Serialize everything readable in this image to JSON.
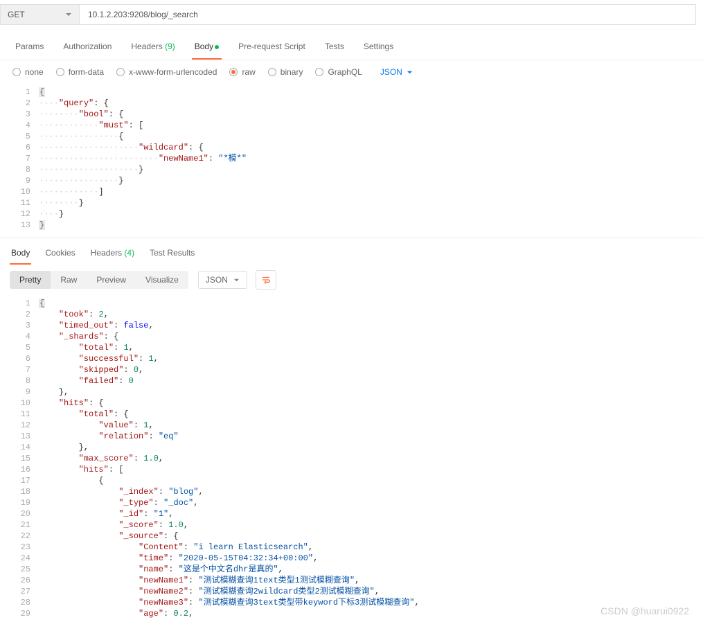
{
  "request": {
    "method": "GET",
    "url": "10.1.2.203:9208/blog/_search"
  },
  "tabs": [
    {
      "label": "Params"
    },
    {
      "label": "Authorization"
    },
    {
      "label": "Headers",
      "count": "(9)"
    },
    {
      "label": "Body",
      "active": true,
      "dot": true
    },
    {
      "label": "Pre-request Script"
    },
    {
      "label": "Tests"
    },
    {
      "label": "Settings"
    }
  ],
  "body_types": [
    {
      "label": "none"
    },
    {
      "label": "form-data"
    },
    {
      "label": "x-www-form-urlencoded"
    },
    {
      "label": "raw",
      "checked": true
    },
    {
      "label": "binary"
    },
    {
      "label": "GraphQL"
    }
  ],
  "lang_select": "JSON",
  "request_body_lines": [
    {
      "n": "1",
      "t": [
        {
          "c": "cursor-mark",
          "v": "{"
        }
      ]
    },
    {
      "n": "2",
      "t": [
        {
          "c": "dot-ws",
          "v": "····"
        },
        {
          "c": "k",
          "v": "\"query\""
        },
        {
          "c": "p",
          "v": ": {"
        }
      ]
    },
    {
      "n": "3",
      "t": [
        {
          "c": "dot-ws",
          "v": "········"
        },
        {
          "c": "k",
          "v": "\"bool\""
        },
        {
          "c": "p",
          "v": ": {"
        }
      ]
    },
    {
      "n": "4",
      "t": [
        {
          "c": "dot-ws",
          "v": "············"
        },
        {
          "c": "k",
          "v": "\"must\""
        },
        {
          "c": "p",
          "v": ": ["
        }
      ]
    },
    {
      "n": "5",
      "t": [
        {
          "c": "dot-ws",
          "v": "················"
        },
        {
          "c": "p",
          "v": "{"
        }
      ]
    },
    {
      "n": "6",
      "t": [
        {
          "c": "dot-ws",
          "v": "····················"
        },
        {
          "c": "k",
          "v": "\"wildcard\""
        },
        {
          "c": "p",
          "v": ": {"
        }
      ]
    },
    {
      "n": "7",
      "t": [
        {
          "c": "dot-ws",
          "v": "························"
        },
        {
          "c": "k",
          "v": "\"newName1\""
        },
        {
          "c": "p",
          "v": ": "
        },
        {
          "c": "s",
          "v": "\"*模*\""
        }
      ]
    },
    {
      "n": "8",
      "t": [
        {
          "c": "dot-ws",
          "v": "····················"
        },
        {
          "c": "p",
          "v": "}"
        }
      ]
    },
    {
      "n": "9",
      "t": [
        {
          "c": "dot-ws",
          "v": "················"
        },
        {
          "c": "p",
          "v": "}"
        }
      ]
    },
    {
      "n": "10",
      "t": [
        {
          "c": "dot-ws",
          "v": "············"
        },
        {
          "c": "p",
          "v": "]"
        }
      ]
    },
    {
      "n": "11",
      "t": [
        {
          "c": "dot-ws",
          "v": "········"
        },
        {
          "c": "p",
          "v": "}"
        }
      ]
    },
    {
      "n": "12",
      "t": [
        {
          "c": "dot-ws",
          "v": "····"
        },
        {
          "c": "p",
          "v": "}"
        }
      ]
    },
    {
      "n": "13",
      "t": [
        {
          "c": "cursor-mark",
          "v": "}"
        }
      ]
    }
  ],
  "response_tabs": [
    {
      "label": "Body",
      "active": true
    },
    {
      "label": "Cookies"
    },
    {
      "label": "Headers",
      "count": "(4)"
    },
    {
      "label": "Test Results"
    }
  ],
  "view_modes": [
    {
      "label": "Pretty",
      "active": true
    },
    {
      "label": "Raw"
    },
    {
      "label": "Preview"
    },
    {
      "label": "Visualize"
    }
  ],
  "resp_fmt": "JSON",
  "response_body_lines": [
    {
      "n": "1",
      "t": [
        {
          "c": "cursor-mark",
          "v": "{"
        }
      ]
    },
    {
      "n": "2",
      "t": [
        {
          "c": "p",
          "v": "    "
        },
        {
          "c": "k",
          "v": "\"took\""
        },
        {
          "c": "p",
          "v": ": "
        },
        {
          "c": "n",
          "v": "2"
        },
        {
          "c": "p",
          "v": ","
        }
      ]
    },
    {
      "n": "3",
      "t": [
        {
          "c": "p",
          "v": "    "
        },
        {
          "c": "k",
          "v": "\"timed_out\""
        },
        {
          "c": "p",
          "v": ": "
        },
        {
          "c": "b",
          "v": "false"
        },
        {
          "c": "p",
          "v": ","
        }
      ]
    },
    {
      "n": "4",
      "t": [
        {
          "c": "p",
          "v": "    "
        },
        {
          "c": "k",
          "v": "\"_shards\""
        },
        {
          "c": "p",
          "v": ": {"
        }
      ]
    },
    {
      "n": "5",
      "t": [
        {
          "c": "p",
          "v": "        "
        },
        {
          "c": "k",
          "v": "\"total\""
        },
        {
          "c": "p",
          "v": ": "
        },
        {
          "c": "n",
          "v": "1"
        },
        {
          "c": "p",
          "v": ","
        }
      ]
    },
    {
      "n": "6",
      "t": [
        {
          "c": "p",
          "v": "        "
        },
        {
          "c": "k",
          "v": "\"successful\""
        },
        {
          "c": "p",
          "v": ": "
        },
        {
          "c": "n",
          "v": "1"
        },
        {
          "c": "p",
          "v": ","
        }
      ]
    },
    {
      "n": "7",
      "t": [
        {
          "c": "p",
          "v": "        "
        },
        {
          "c": "k",
          "v": "\"skipped\""
        },
        {
          "c": "p",
          "v": ": "
        },
        {
          "c": "n",
          "v": "0"
        },
        {
          "c": "p",
          "v": ","
        }
      ]
    },
    {
      "n": "8",
      "t": [
        {
          "c": "p",
          "v": "        "
        },
        {
          "c": "k",
          "v": "\"failed\""
        },
        {
          "c": "p",
          "v": ": "
        },
        {
          "c": "n",
          "v": "0"
        }
      ]
    },
    {
      "n": "9",
      "t": [
        {
          "c": "p",
          "v": "    },"
        }
      ]
    },
    {
      "n": "10",
      "t": [
        {
          "c": "p",
          "v": "    "
        },
        {
          "c": "k",
          "v": "\"hits\""
        },
        {
          "c": "p",
          "v": ": {"
        }
      ]
    },
    {
      "n": "11",
      "t": [
        {
          "c": "p",
          "v": "        "
        },
        {
          "c": "k",
          "v": "\"total\""
        },
        {
          "c": "p",
          "v": ": {"
        }
      ]
    },
    {
      "n": "12",
      "t": [
        {
          "c": "p",
          "v": "            "
        },
        {
          "c": "k",
          "v": "\"value\""
        },
        {
          "c": "p",
          "v": ": "
        },
        {
          "c": "n",
          "v": "1"
        },
        {
          "c": "p",
          "v": ","
        }
      ]
    },
    {
      "n": "13",
      "t": [
        {
          "c": "p",
          "v": "            "
        },
        {
          "c": "k",
          "v": "\"relation\""
        },
        {
          "c": "p",
          "v": ": "
        },
        {
          "c": "s",
          "v": "\"eq\""
        }
      ]
    },
    {
      "n": "14",
      "t": [
        {
          "c": "p",
          "v": "        },"
        }
      ]
    },
    {
      "n": "15",
      "t": [
        {
          "c": "p",
          "v": "        "
        },
        {
          "c": "k",
          "v": "\"max_score\""
        },
        {
          "c": "p",
          "v": ": "
        },
        {
          "c": "n",
          "v": "1.0"
        },
        {
          "c": "p",
          "v": ","
        }
      ]
    },
    {
      "n": "16",
      "t": [
        {
          "c": "p",
          "v": "        "
        },
        {
          "c": "k",
          "v": "\"hits\""
        },
        {
          "c": "p",
          "v": ": ["
        }
      ]
    },
    {
      "n": "17",
      "t": [
        {
          "c": "p",
          "v": "            {"
        }
      ]
    },
    {
      "n": "18",
      "t": [
        {
          "c": "p",
          "v": "                "
        },
        {
          "c": "k",
          "v": "\"_index\""
        },
        {
          "c": "p",
          "v": ": "
        },
        {
          "c": "s",
          "v": "\"blog\""
        },
        {
          "c": "p",
          "v": ","
        }
      ]
    },
    {
      "n": "19",
      "t": [
        {
          "c": "p",
          "v": "                "
        },
        {
          "c": "k",
          "v": "\"_type\""
        },
        {
          "c": "p",
          "v": ": "
        },
        {
          "c": "s",
          "v": "\"_doc\""
        },
        {
          "c": "p",
          "v": ","
        }
      ]
    },
    {
      "n": "20",
      "t": [
        {
          "c": "p",
          "v": "                "
        },
        {
          "c": "k",
          "v": "\"_id\""
        },
        {
          "c": "p",
          "v": ": "
        },
        {
          "c": "s",
          "v": "\"1\""
        },
        {
          "c": "p",
          "v": ","
        }
      ]
    },
    {
      "n": "21",
      "t": [
        {
          "c": "p",
          "v": "                "
        },
        {
          "c": "k",
          "v": "\"_score\""
        },
        {
          "c": "p",
          "v": ": "
        },
        {
          "c": "n",
          "v": "1.0"
        },
        {
          "c": "p",
          "v": ","
        }
      ]
    },
    {
      "n": "22",
      "t": [
        {
          "c": "p",
          "v": "                "
        },
        {
          "c": "k",
          "v": "\"_source\""
        },
        {
          "c": "p",
          "v": ": {"
        }
      ]
    },
    {
      "n": "23",
      "t": [
        {
          "c": "p",
          "v": "                    "
        },
        {
          "c": "k",
          "v": "\"Content\""
        },
        {
          "c": "p",
          "v": ": "
        },
        {
          "c": "s",
          "v": "\"i learn Elasticsearch\""
        },
        {
          "c": "p",
          "v": ","
        }
      ]
    },
    {
      "n": "24",
      "t": [
        {
          "c": "p",
          "v": "                    "
        },
        {
          "c": "k",
          "v": "\"time\""
        },
        {
          "c": "p",
          "v": ": "
        },
        {
          "c": "s",
          "v": "\"2020-05-15T04:32:34+00:00\""
        },
        {
          "c": "p",
          "v": ","
        }
      ]
    },
    {
      "n": "25",
      "t": [
        {
          "c": "p",
          "v": "                    "
        },
        {
          "c": "k",
          "v": "\"name\""
        },
        {
          "c": "p",
          "v": ": "
        },
        {
          "c": "s",
          "v": "\"这是个中文名dhr是真的\""
        },
        {
          "c": "p",
          "v": ","
        }
      ]
    },
    {
      "n": "26",
      "t": [
        {
          "c": "p",
          "v": "                    "
        },
        {
          "c": "k",
          "v": "\"newName1\""
        },
        {
          "c": "p",
          "v": ": "
        },
        {
          "c": "s",
          "v": "\"测试模糊查询1text类型1测试模糊查询\""
        },
        {
          "c": "p",
          "v": ","
        }
      ]
    },
    {
      "n": "27",
      "t": [
        {
          "c": "p",
          "v": "                    "
        },
        {
          "c": "k",
          "v": "\"newName2\""
        },
        {
          "c": "p",
          "v": ": "
        },
        {
          "c": "s",
          "v": "\"测试模糊查询2wildcard类型2测试模糊查询\""
        },
        {
          "c": "p",
          "v": ","
        }
      ]
    },
    {
      "n": "28",
      "t": [
        {
          "c": "p",
          "v": "                    "
        },
        {
          "c": "k",
          "v": "\"newName3\""
        },
        {
          "c": "p",
          "v": ": "
        },
        {
          "c": "s",
          "v": "\"测试模糊查询3text类型带keyword下标3测试模糊查询\""
        },
        {
          "c": "p",
          "v": ","
        }
      ]
    },
    {
      "n": "29",
      "t": [
        {
          "c": "p",
          "v": "                    "
        },
        {
          "c": "k",
          "v": "\"age\""
        },
        {
          "c": "p",
          "v": ": "
        },
        {
          "c": "n",
          "v": "0.2"
        },
        {
          "c": "p",
          "v": ","
        }
      ]
    }
  ],
  "watermark": "CSDN @huarui0922"
}
